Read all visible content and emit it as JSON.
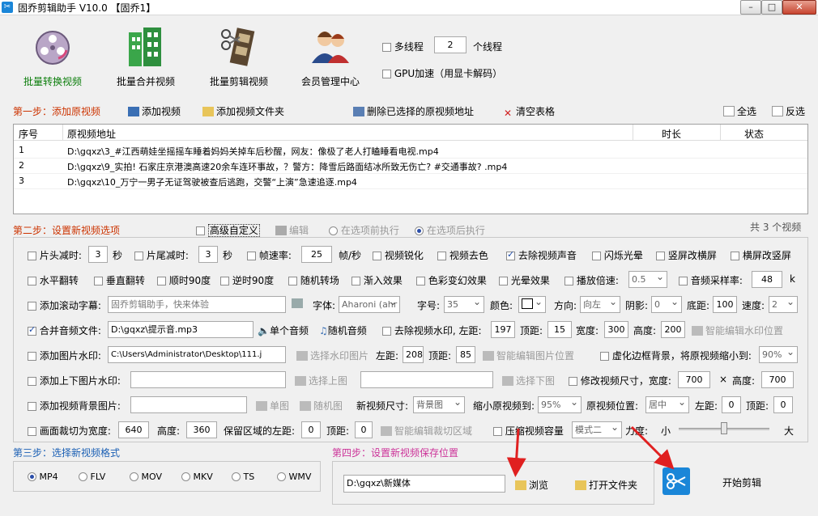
{
  "window": {
    "title": "固乔剪辑助手 V10.0  【固乔1】"
  },
  "toolbar": {
    "batch_convert": "批量转换视频",
    "batch_merge": "批量合并视频",
    "batch_edit": "批量剪辑视频",
    "member": "会员管理中心",
    "multithread_label": "多线程",
    "thread_count": "2",
    "thread_unit": "个线程",
    "gpu_label": "GPU加速（用显卡解码）"
  },
  "step1": {
    "label": "第一步：添加原视频",
    "add_video": "添加视频",
    "add_folder": "添加视频文件夹",
    "delete_selected": "删除已选择的原视频地址",
    "clear_table": "清空表格",
    "select_all": "全选",
    "invert": "反选"
  },
  "table": {
    "headers": [
      "序号",
      "原视频地址",
      "时长",
      "状态"
    ],
    "rows": [
      [
        "1",
        "D:\\gqxz\\3_#江西萌娃坐摇摇车睡着妈妈关掉车后秒醒，网友：像极了老人打瞌睡看电视.mp4"
      ],
      [
        "2",
        "D:\\gqxz\\9_实拍! 石家庄京港澳高速20余车连环事故，？警方：降雪后路面结冰所致无伤亡? #交通事故? .mp4"
      ],
      [
        "3",
        "D:\\gqxz\\10_万宁一男子无证驾驶被查后逃跑，交警“上演”急速追逐.mp4"
      ]
    ]
  },
  "step2": {
    "label": "第二步：设置新视频选项",
    "advanced": "高级自定义",
    "edit": "编辑",
    "before": "在选项前执行",
    "after": "在选项后执行",
    "count": "共 3 个视频"
  },
  "opts": {
    "head_cut": "片头减时:",
    "head_val": "3",
    "sec": "秒",
    "tail_cut": "片尾减时:",
    "tail_val": "3",
    "fps": "帧速率:",
    "fps_val": "25",
    "fps_unit": "帧/秒",
    "sharpen": "视频锐化",
    "decolor": "视频去色",
    "remove_audio": "去除视频声音",
    "flash": "闪烁光晕",
    "v2h": "竖屏改横屏",
    "h2v": "横屏改竖屏",
    "hflip": "水平翻转",
    "vflip": "垂直翻转",
    "cw90": "顺时90度",
    "ccw90": "逆时90度",
    "random_trans": "随机转场",
    "fade_in": "渐入效果",
    "color_fx": "色彩变幻效果",
    "halo_fx": "光晕效果",
    "speed": "播放倍速:",
    "speed_val": "0.5",
    "sample_rate": "音频采样率:",
    "sample_val": "48",
    "k": "k",
    "scroll_sub": "添加滚动字幕:",
    "scroll_text": "固乔剪辑助手，快来体验",
    "font": "字体:",
    "font_val": "Aharoni (ahr",
    "size": "字号:",
    "size_val": "35",
    "color": "颜色:",
    "dir": "方向:",
    "dir_val": "向左",
    "shadow": "阴影:",
    "shadow_val": "0",
    "bottom": "底距:",
    "bottom_val": "100",
    "spd": "速度:",
    "spd_val": "2",
    "merge_audio": "合并音频文件:",
    "audio_path": "D:\\gqxz\\提示音.mp3",
    "single_audio": "单个音频",
    "random_audio": "随机音频",
    "remove_wm": "去除视频水印,",
    "left": "左距:",
    "wm_left": "197",
    "top": "顶距:",
    "wm_top": "15",
    "width": "宽度:",
    "wm_w": "300",
    "height": "高度:",
    "wm_h": "200",
    "smart_wm": "智能编辑水印位置",
    "img_wm": "添加图片水印:",
    "img_path": "C:\\Users\\Administrator\\Desktop\\111.j",
    "choose_wm_img": "选择水印图片",
    "img_left": "208",
    "img_top": "85",
    "smart_img": "智能编辑图片位置",
    "blur_bg": "虚化边框背景，将原视频缩小到:",
    "blur_val": "90%",
    "tb_wm": "添加上下图片水印:",
    "choose_top": "选择上图",
    "choose_bottom": "选择下图",
    "resize": "修改视频尺寸，宽度:",
    "resize_w": "700",
    "times": "×",
    "resize_h_label": "高度:",
    "resize_h": "700",
    "bg_img": "添加视频背景图片:",
    "single_img": "单图",
    "random_img": "随机图",
    "new_size": "新视频尺寸:",
    "new_size_val": "背景图",
    "shrink": "缩小原视频到:",
    "shrink_val": "95%",
    "position": "原视频位置:",
    "position_val": "居中",
    "pos_left": "0",
    "pos_top": "0",
    "crop_w": "画面裁切为宽度:",
    "crop_w_val": "640",
    "crop_h_val": "360",
    "keep_left": "保留区域的左距:",
    "keep_left_val": "0",
    "keep_top": "顶距:",
    "keep_top_val": "0",
    "smart_crop": "智能编辑裁切区域",
    "compress": "压缩视频容量",
    "mode_val": "模式二",
    "force": "力度:",
    "small": "小",
    "big": "大"
  },
  "step3": {
    "label": "第三步：选择新视频格式",
    "formats": [
      "MP4",
      "FLV",
      "MOV",
      "MKV",
      "TS",
      "WMV"
    ]
  },
  "step4": {
    "label": "第四步：设置新视频保存位置",
    "path": "D:\\gqxz\\新媒体",
    "browse": "浏览",
    "open_folder": "打开文件夹",
    "start": "开始剪辑"
  },
  "colors": {
    "accent": "#1a86d8",
    "step": "#cc3300",
    "step4": "#cc3399",
    "arrow": "#e02020"
  }
}
